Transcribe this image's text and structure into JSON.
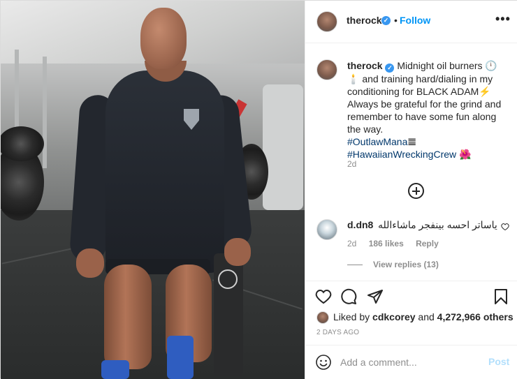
{
  "post": {
    "username": "therock",
    "follow_label": "Follow",
    "dot": "•",
    "more_label": "•••",
    "caption_text": "Midnight oil burners 🕛🕯️ and training hard/dialing in my conditioning for BLACK ADAM⚡️ Always be grateful for the grind and remember to have some fun along the way.",
    "hashtag_1": "#OutlawMana",
    "hashtag_1_suffix": "𝌆",
    "hashtag_2": "#HawaiianWreckingCrew",
    "hashtag_2_suffix": "🌺",
    "caption_time": "2d",
    "load_more_icon": "plus-circle-icon"
  },
  "comment": {
    "username": "d.dn8",
    "text": "ياساتر احسه بينفجر ماشاءالله",
    "time": "2d",
    "likes": "186 likes",
    "reply": "Reply",
    "view_replies": "View replies (13)"
  },
  "actions": {
    "liked_prefix": "Liked by",
    "liked_user": "cdkcorey",
    "liked_and": "and",
    "liked_count": "4,272,966 others",
    "posted_ago": "2 DAYS AGO",
    "comment_placeholder": "Add a comment...",
    "post_label": "Post"
  },
  "colors": {
    "accent": "#0095f6",
    "hashtag": "#00376b",
    "muted": "#8e8e8e",
    "post_disabled": "#b2dffc"
  }
}
